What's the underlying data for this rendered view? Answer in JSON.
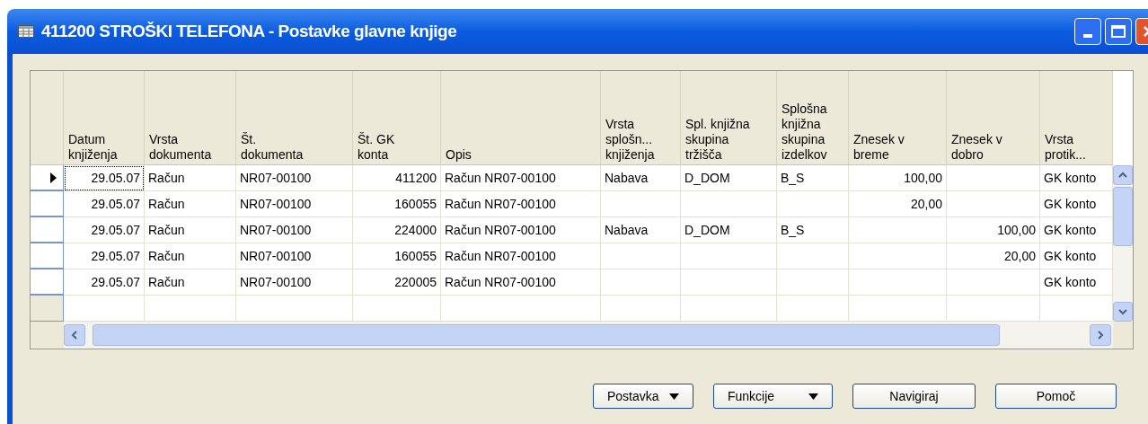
{
  "window": {
    "title": "411200 STROŠKI TELEFONA - Postavke glavne knjige"
  },
  "table": {
    "columns": [
      {
        "label": "Datum\nknjiženja"
      },
      {
        "label": "Vrsta\ndokumenta"
      },
      {
        "label": "Št.\ndokumenta"
      },
      {
        "label": "Št. GK\nkonta"
      },
      {
        "label": "Opis"
      },
      {
        "label": "Vrsta\nsplošn...\nknjiženja"
      },
      {
        "label": "Spl. knjižna\nskupina\ntržišča"
      },
      {
        "label": "Splošna\nknjižna\nskupina\nizdelkov"
      },
      {
        "label": "Znesek v\nbreme"
      },
      {
        "label": "Znesek v\ndobro"
      },
      {
        "label": "Vrsta\nprotik..."
      }
    ],
    "rows": [
      {
        "selected": true,
        "cells": [
          "29.05.07",
          "Račun",
          "NR07-00100",
          "411200",
          "Račun NR07-00100",
          "Nabava",
          "D_DOM",
          "B_S",
          "100,00",
          null,
          "GK konto"
        ]
      },
      {
        "selected": false,
        "cells": [
          "29.05.07",
          "Račun",
          "NR07-00100",
          "160055",
          "Račun NR07-00100",
          null,
          null,
          null,
          "20,00",
          null,
          "GK konto"
        ]
      },
      {
        "selected": false,
        "cells": [
          "29.05.07",
          "Račun",
          "NR07-00100",
          "224000",
          "Račun NR07-00100",
          "Nabava",
          "D_DOM",
          "B_S",
          null,
          "100,00",
          "GK konto"
        ]
      },
      {
        "selected": false,
        "cells": [
          "29.05.07",
          "Račun",
          "NR07-00100",
          "160055",
          "Račun NR07-00100",
          null,
          null,
          null,
          null,
          "20,00",
          "GK konto"
        ]
      },
      {
        "selected": false,
        "cells": [
          "29.05.07",
          "Račun",
          "NR07-00100",
          "220005",
          "Račun NR07-00100",
          null,
          null,
          null,
          null,
          null,
          "GK konto"
        ]
      }
    ]
  },
  "buttons": [
    {
      "label": "Postavka",
      "kind": "dropdown"
    },
    {
      "label": "Funkcije",
      "kind": "dropdown"
    },
    {
      "label": "Navigiraj",
      "kind": "plain"
    },
    {
      "label": "Pomoč",
      "kind": "plain"
    }
  ]
}
